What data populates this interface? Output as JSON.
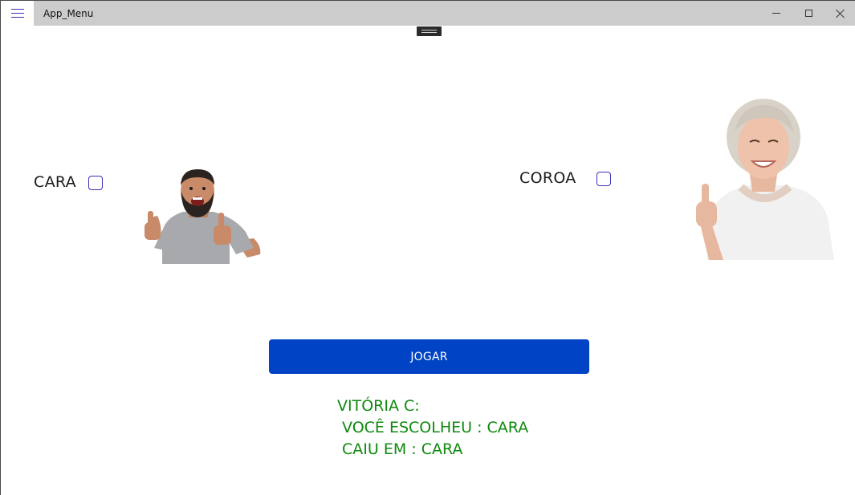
{
  "window": {
    "title": "App_Menu"
  },
  "icons": {
    "menu": "hamburger-icon",
    "minimize": "minimize-icon",
    "maximize": "maximize-icon",
    "close": "close-icon"
  },
  "options": {
    "heads": {
      "label": "CARA",
      "checked": false
    },
    "tails": {
      "label": "COROA",
      "checked": false
    }
  },
  "play_button": {
    "label": "JOGAR"
  },
  "result": {
    "line1": "VITÓRIA C:",
    "line2": " VOCÊ ESCOLHEU : CARA",
    "line3": " CAIU EM : CARA"
  },
  "colors": {
    "accent": "#3b32b7",
    "button": "#0043c4",
    "result_text": "#0d8a0d",
    "titlebar": "#cccccc"
  }
}
